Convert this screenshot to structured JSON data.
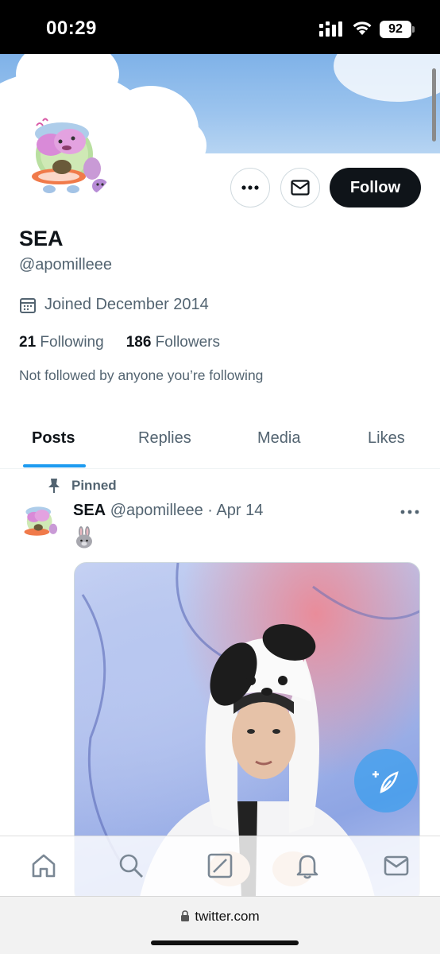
{
  "status_bar": {
    "time": "00:29",
    "battery": "92"
  },
  "profile": {
    "display_name": "SEA",
    "handle": "@apomilleee",
    "joined": "Joined December 2014",
    "following_count": "21",
    "following_label": "Following",
    "followers_count": "186",
    "followers_label": "Followers",
    "not_followed_text": "Not followed by anyone you’re following",
    "follow_label": "Follow"
  },
  "tabs": [
    {
      "label": "Posts",
      "active": true
    },
    {
      "label": "Replies",
      "active": false
    },
    {
      "label": "Media",
      "active": false
    },
    {
      "label": "Likes",
      "active": false
    }
  ],
  "post": {
    "pinned_label": "Pinned",
    "author_name": "SEA",
    "author_handle": "@apomilleee",
    "separator": "·",
    "date": "Apr 14"
  },
  "bottom_nav": [
    "home-icon",
    "search-icon",
    "grok-icon",
    "notifications-icon",
    "messages-icon"
  ],
  "browser": {
    "url": "twitter.com"
  },
  "colors": {
    "accent": "#1d9bf0",
    "text": "#0f1419",
    "secondary": "#536471",
    "follow_bg": "#0f1419"
  }
}
